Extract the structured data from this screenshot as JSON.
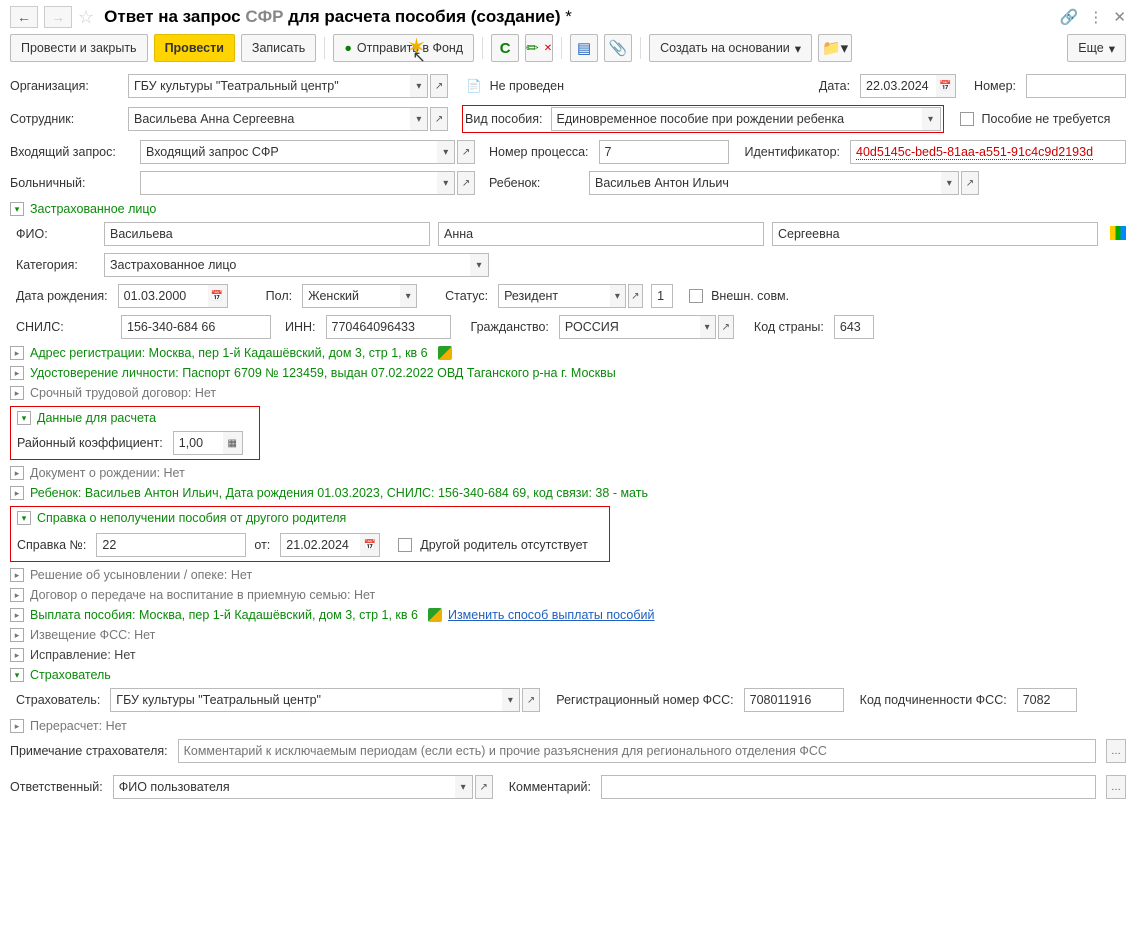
{
  "header": {
    "title_prefix": "Ответ на запрос ",
    "title_sfr": "СФР",
    "title_suffix": " для расчета пособия (создание) ",
    "star": "*"
  },
  "toolbar": {
    "post_close": "Провести и закрыть",
    "post": "Провести",
    "write": "Записать",
    "send": "Отправить в Фонд",
    "create_based": "Создать на основании",
    "more": "Еще"
  },
  "doc": {
    "org_label": "Организация:",
    "org_value": "ГБУ культуры \"Театральный центр\"",
    "not_posted": "Не проведен",
    "date_label": "Дата:",
    "date_value": "22.03.2024",
    "number_label": "Номер:",
    "number_value": "",
    "emp_label": "Сотрудник:",
    "emp_value": "Васильева Анна Сергеевна",
    "benefit_type_label": "Вид пособия:",
    "benefit_type_value": "Единовременное пособие при рождении ребенка",
    "benefit_not_needed": "Пособие не требуется",
    "inreq_label": "Входящий запрос:",
    "inreq_value": "Входящий запрос СФР",
    "process_label": "Номер процесса:",
    "process_value": "7",
    "id_label": "Идентификатор:",
    "id_value": "40d5145c-bed5-81aa-a551-91c4c9d2193d",
    "sick_label": "Больничный:",
    "child_label": "Ребенок:",
    "child_value": "Васильев Антон Ильич"
  },
  "insured": {
    "section": "Застрахованное лицо",
    "fio_label": "ФИО:",
    "surname": "Васильева",
    "name": "Анна",
    "patronymic": "Сергеевна",
    "category_label": "Категория:",
    "category_value": "Застрахованное лицо",
    "dob_label": "Дата рождения:",
    "dob_value": "01.03.2000",
    "sex_label": "Пол:",
    "sex_value": "Женский",
    "status_label": "Статус:",
    "status_value": "Резидент",
    "status_code": "1",
    "ext_combine": "Внешн. совм.",
    "snils_label": "СНИЛС:",
    "snils_value": "156-340-684 66",
    "inn_label": "ИНН:",
    "inn_value": "770464096433",
    "citizen_label": "Гражданство:",
    "citizen_value": "РОССИЯ",
    "country_code_label": "Код страны:",
    "country_code": "643",
    "addr": "Адрес регистрации: Москва, пер 1-й Кадашёвский, дом 3, стр 1, кв 6",
    "identity": "Удостоверение личности: Паспорт 6709 № 123459, выдан 07.02.2022 ОВД Таганского р-на г. Москвы",
    "contract": "Срочный трудовой договор: Нет"
  },
  "calc": {
    "section": "Данные для расчета",
    "coeff_label": "Районный коэффициент:",
    "coeff_value": "1,00"
  },
  "sections": {
    "birth_doc": "Документ о рождении: Нет",
    "child": "Ребенок: Васильев Антон Ильич, Дата рождения 01.03.2023, СНИЛС: 156-340-684 69, код связи: 38 - мать",
    "noparent_section": "Справка о неполучении пособия от другого родителя",
    "cert_no_label": "Справка №:",
    "cert_no": "22",
    "cert_date_label": "от:",
    "cert_date": "21.02.2024",
    "other_parent_absent": "Другой родитель отсутствует",
    "adoption": "Решение об усыновлении / опеке: Нет",
    "foster": "Договор о передаче на воспитание в приемную семью: Нет",
    "payout_prefix": "Выплата пособия: Москва, пер 1-й Кадашёвский, дом 3, стр 1, кв 6",
    "payout_link": "Изменить способ выплаты пособий",
    "fss_notice": "Извещение ФСС: Нет",
    "correction": "Исправление: Нет"
  },
  "insurer": {
    "section": "Страхователь",
    "label": "Страхователь:",
    "value": "ГБУ культуры \"Театральный центр\"",
    "reg_label": "Регистрационный номер ФСС:",
    "reg_value": "708011916",
    "sub_label": "Код подчиненности ФСС:",
    "sub_value": "7082",
    "recalc": "Перерасчет: Нет",
    "note_label": "Примечание страхователя:",
    "note_placeholder": "Комментарий к исключаемым периодам (если есть) и прочие разъяснения для регионального отделения ФСС"
  },
  "footer": {
    "resp_label": "Ответственный:",
    "resp_value": "ФИО пользователя",
    "comment_label": "Комментарий:"
  }
}
